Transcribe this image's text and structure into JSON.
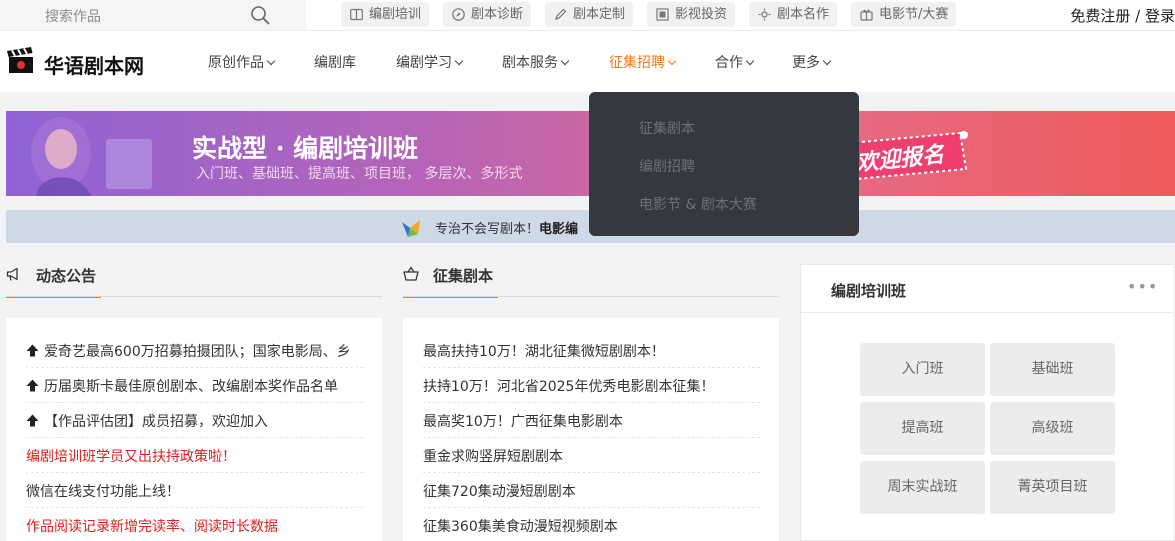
{
  "topbar": {
    "search_placeholder": "搜索作品",
    "quick_links": [
      {
        "label": "编剧培训",
        "icon": "book-icon"
      },
      {
        "label": "剧本诊断",
        "icon": "compass-icon"
      },
      {
        "label": "剧本定制",
        "icon": "pen-icon"
      },
      {
        "label": "影视投资",
        "icon": "film-icon"
      },
      {
        "label": "剧本名作",
        "icon": "sun-icon"
      },
      {
        "label": "电影节/大赛",
        "icon": "gift-icon"
      }
    ],
    "register_login": "免费注册 / 登录"
  },
  "header": {
    "logo_text": "华语剧本网",
    "nav": [
      {
        "label": "原创作品",
        "has_caret": true
      },
      {
        "label": "编剧库",
        "has_caret": false
      },
      {
        "label": "编剧学习",
        "has_caret": true
      },
      {
        "label": "剧本服务",
        "has_caret": true
      },
      {
        "label": "征集招聘",
        "has_caret": true,
        "active": true
      },
      {
        "label": "合作",
        "has_caret": true
      },
      {
        "label": "更多",
        "has_caret": true
      }
    ]
  },
  "dropdown": {
    "items": [
      "征集剧本",
      "编剧招聘",
      "电影节 & 剧本大赛"
    ]
  },
  "banner": {
    "title": "实战型 · 编剧培训班",
    "subtitle": "入门班、基础班、提高班、项目班， 多层次、多形式",
    "stamp": "欢迎报名"
  },
  "notice": {
    "text": "专治不会写剧本！",
    "bold": "电影编"
  },
  "announcements": {
    "title": "动态公告",
    "items": [
      {
        "text": "爱奇艺最高600万招募拍摄团队；国家电影局、乡",
        "pinned": true,
        "red": false
      },
      {
        "text": "历届奥斯卡最佳原创剧本、改编剧本奖作品名单",
        "pinned": true,
        "red": false
      },
      {
        "text": "【作品评估团】成员招募，欢迎加入",
        "pinned": true,
        "red": false
      },
      {
        "text": "编剧培训班学员又出扶持政策啦！",
        "pinned": false,
        "red": true
      },
      {
        "text": "微信在线支付功能上线！",
        "pinned": false,
        "red": false
      },
      {
        "text": "作品阅读记录新增完读率、阅读时长数据",
        "pinned": false,
        "red": true
      }
    ]
  },
  "scripts": {
    "title": "征集剧本",
    "items": [
      "最高扶持10万！湖北征集微短剧剧本！",
      "扶持10万！河北省2025年优秀电影剧本征集！",
      "最高奖10万！广西征集电影剧本",
      "重金求购竖屏短剧剧本",
      "征集720集动漫短剧剧本",
      "征集360集美食动漫短视频剧本"
    ]
  },
  "training": {
    "title": "编剧培训班",
    "more": "•••",
    "classes": [
      "入门班",
      "基础班",
      "提高班",
      "高级班",
      "周末实战班",
      "菁英项目班"
    ]
  },
  "colors": {
    "accent": "#ef7a1f",
    "red_text": "#e02020",
    "dropdown_bg": "#35383f"
  }
}
